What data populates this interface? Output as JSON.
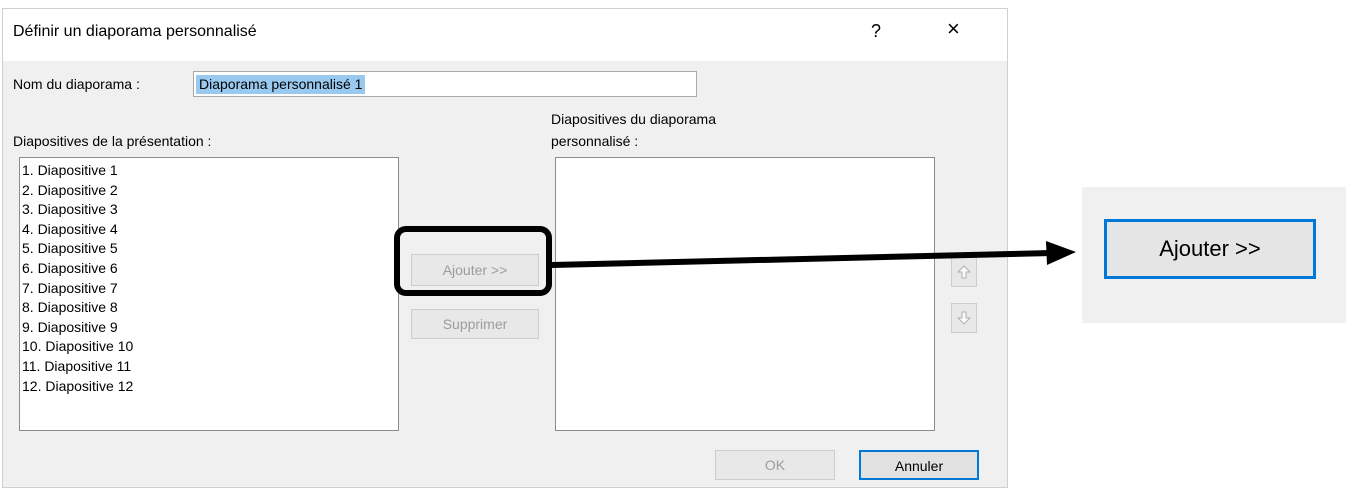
{
  "dialog": {
    "title": "Définir un diaporama personnalisé",
    "help_label": "?",
    "close_label": "×",
    "name_label": "Nom du diaporama :",
    "name_value": "Diaporama personnalisé 1",
    "slides_label": "Diapositives de la présentation :",
    "slides": [
      "1. Diapositive 1",
      "2. Diapositive 2",
      "3. Diapositive 3",
      "4. Diapositive 4",
      "5. Diapositive 5",
      "6. Diapositive 6",
      "7. Diapositive 7",
      "8. Diapositive 8",
      "9. Diapositive 9",
      "10. Diapositive 10",
      "11. Diapositive 11",
      "12. Diapositive 12"
    ],
    "custom_label_line1": "Diapositives du diaporama",
    "custom_label_line2": "personnalisé :",
    "add_label": "Ajouter >>",
    "remove_label": "Supprimer",
    "ok_label": "OK",
    "cancel_label": "Annuler"
  },
  "zoom": {
    "add_label": "Ajouter >>"
  },
  "colors": {
    "accent": "#0078d7",
    "selection": "#99c9ef",
    "callout": "#000000"
  }
}
